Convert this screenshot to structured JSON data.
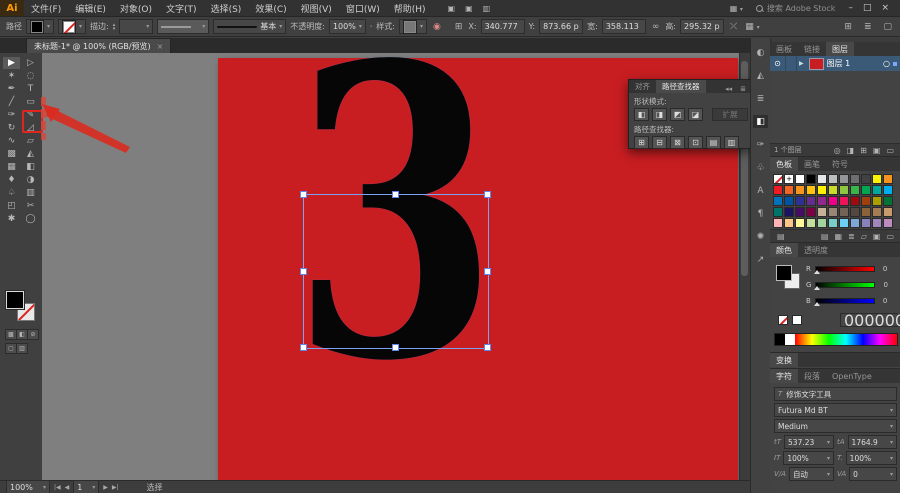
{
  "menu_bar": {
    "logo": "Ai",
    "items": [
      "文件(F)",
      "编辑(E)",
      "对象(O)",
      "文字(T)",
      "选择(S)",
      "效果(C)",
      "视图(V)",
      "窗口(W)",
      "帮助(H)"
    ],
    "quick_icons": [
      "▣",
      "▣",
      "▥"
    ],
    "workspace_icon": "▦",
    "search_label": "搜索 Adobe Stock",
    "window_controls": [
      {
        "name": "minimize-button",
        "glyph": "–"
      },
      {
        "name": "maximize-button",
        "glyph": "□"
      },
      {
        "name": "close-button",
        "glyph": "×"
      }
    ]
  },
  "control_bar": {
    "context_label": "路径",
    "stroke_label": "描边:",
    "brush_value": "基本",
    "opacity_label": "不透明度:",
    "opacity_value": "100%",
    "style_label": "样式:",
    "ref_icon": "⊞",
    "x_label": "X:",
    "x_value": "340.777",
    "y_label": "Y:",
    "y_value": "873.66 p",
    "w_label": "宽:",
    "w_value": "358.113",
    "link_icon": "∞",
    "h_label": "高:",
    "h_value": "295.32 p",
    "extra_icons": [
      "⤫",
      "▦"
    ],
    "right_icons": [
      "⊞",
      "≣",
      "▢"
    ]
  },
  "document_tab": {
    "title": "未标题-1* @ 100% (RGB/预览)",
    "close_glyph": "×"
  },
  "toolbar": {
    "tools": [
      {
        "name": "selection-tool",
        "glyph": "▶",
        "active": true
      },
      {
        "name": "direct-selection-tool",
        "glyph": "▷"
      },
      {
        "name": "magic-wand-tool",
        "glyph": "✶"
      },
      {
        "name": "lasso-tool",
        "glyph": "◌"
      },
      {
        "name": "pen-tool",
        "glyph": "✒"
      },
      {
        "name": "type-tool",
        "glyph": "T"
      },
      {
        "name": "line-segment-tool",
        "glyph": "╱"
      },
      {
        "name": "rectangle-tool",
        "glyph": "▭"
      },
      {
        "name": "paintbrush-tool",
        "glyph": "✑"
      },
      {
        "name": "pencil-tool",
        "glyph": "✎"
      },
      {
        "name": "rotate-tool",
        "glyph": "↻"
      },
      {
        "name": "scale-tool",
        "glyph": "◿"
      },
      {
        "name": "width-tool",
        "glyph": "∿"
      },
      {
        "name": "free-transform-tool",
        "glyph": "▱"
      },
      {
        "name": "shape-builder-tool",
        "glyph": "▩"
      },
      {
        "name": "perspective-grid-tool",
        "glyph": "◭"
      },
      {
        "name": "mesh-tool",
        "glyph": "▦"
      },
      {
        "name": "gradient-tool",
        "glyph": "◧"
      },
      {
        "name": "eyedropper-tool",
        "glyph": "♦"
      },
      {
        "name": "blend-tool",
        "glyph": "◑"
      },
      {
        "name": "symbol-sprayer-tool",
        "glyph": "♤"
      },
      {
        "name": "column-graph-tool",
        "glyph": "▥"
      },
      {
        "name": "artboard-tool",
        "glyph": "◰"
      },
      {
        "name": "slice-tool",
        "glyph": "✂"
      },
      {
        "name": "hand-tool",
        "glyph": "✱"
      },
      {
        "name": "zoom-tool",
        "glyph": "◯"
      }
    ]
  },
  "canvas": {
    "artboard_color": "#c81e22",
    "glyph": "3"
  },
  "pathfinder_panel": {
    "tabs": [
      {
        "label": "对齐",
        "active": false
      },
      {
        "label": "路径查找器",
        "active": true
      }
    ],
    "collapse_icon": "◂◂",
    "menu_icon": "≣",
    "shape_modes_label": "形状模式:",
    "shape_mode_icons": [
      {
        "name": "unite",
        "glyph": "◧"
      },
      {
        "name": "minus-front",
        "glyph": "◨"
      },
      {
        "name": "intersect",
        "glyph": "◩"
      },
      {
        "name": "exclude",
        "glyph": "◪"
      }
    ],
    "expand_label": "扩展",
    "pathfinders_label": "路径查找器:",
    "pathfinder_icons": [
      {
        "name": "divide",
        "glyph": "⊞"
      },
      {
        "name": "trim",
        "glyph": "⊟"
      },
      {
        "name": "merge",
        "glyph": "⊠"
      },
      {
        "name": "crop",
        "glyph": "⊡"
      },
      {
        "name": "outline",
        "glyph": "▤"
      },
      {
        "name": "minus-back",
        "glyph": "▥"
      }
    ]
  },
  "dock_strip": {
    "icons": [
      {
        "name": "color-panel-icon",
        "glyph": "◐"
      },
      {
        "name": "color-guide-panel-icon",
        "glyph": "◭"
      },
      {
        "name": "align-panel-icon",
        "glyph": "≣"
      },
      {
        "name": "pathfinder-panel-icon",
        "glyph": "◧",
        "active": true
      },
      {
        "name": "brushes-panel-icon",
        "glyph": "✑"
      },
      {
        "name": "symbols-panel-icon",
        "glyph": "♧"
      },
      {
        "name": "character-styles-panel-icon",
        "glyph": "A"
      },
      {
        "name": "paragraph-styles-panel-icon",
        "glyph": "¶"
      },
      {
        "name": "glyphs-panel-icon",
        "glyph": "✺"
      },
      {
        "name": "export-panel-icon",
        "glyph": "↗"
      }
    ]
  },
  "layers_panel": {
    "tabs": [
      {
        "label": "画板"
      },
      {
        "label": "链接"
      },
      {
        "label": "图层",
        "active": true
      }
    ],
    "eye_glyph": "⊙",
    "expand_glyph": "▶",
    "layer_name": "图层 1",
    "target_glyph": "○",
    "footer_label": "1 个图层",
    "footer_icons": [
      {
        "name": "locate-object-icon",
        "glyph": "◎"
      },
      {
        "name": "make-clip-mask-icon",
        "glyph": "◨"
      },
      {
        "name": "new-sublayer-icon",
        "glyph": "⊞"
      },
      {
        "name": "new-layer-icon",
        "glyph": "▣"
      },
      {
        "name": "delete-layer-icon",
        "glyph": "▭"
      }
    ]
  },
  "swatches_panel": {
    "tabs": [
      {
        "label": "色板",
        "active": true
      },
      {
        "label": "画笔"
      },
      {
        "label": "符号"
      }
    ],
    "rows": [
      [
        "none",
        "reg",
        "#ffffff",
        "#000000",
        "#e6e7e8",
        "#bcbec0",
        "#939598",
        "#6d6e71",
        "#414042",
        "#fff200",
        "#f7941e"
      ],
      [
        "#ed1c24",
        "#f26522",
        "#f7941e",
        "#ffc20e",
        "#fff200",
        "#cbdb2a",
        "#8dc63f",
        "#39b54a",
        "#00a651",
        "#00a99d",
        "#00aeef"
      ],
      [
        "#0072bc",
        "#0054a6",
        "#2e3192",
        "#662d91",
        "#92278f",
        "#ec008c",
        "#ed145b",
        "#9e0b0f",
        "#a0410d",
        "#aba000",
        "#007236"
      ],
      [
        "#00746b",
        "#1b1464",
        "#440e62",
        "#7b0046",
        "#c7b299",
        "#998675",
        "#736357",
        "#534741",
        "#8c6239",
        "#a67c52",
        "#c69c6d"
      ],
      [
        "#fbb3b3",
        "#fdc689",
        "#fff799",
        "#c4df9b",
        "#a3d39c",
        "#7accc8",
        "#6dcff6",
        "#7da7d9",
        "#8781bd",
        "#a186be",
        "#bd8cbf"
      ]
    ],
    "footer_icons": [
      {
        "name": "swatch-libraries-icon",
        "glyph": "▤"
      },
      {
        "name": "show-swatch-kinds-icon",
        "glyph": "▦"
      },
      {
        "name": "swatch-options-icon",
        "glyph": "≣"
      },
      {
        "name": "new-color-group-icon",
        "glyph": "▱"
      },
      {
        "name": "new-swatch-icon",
        "glyph": "▣"
      },
      {
        "name": "delete-swatch-icon",
        "glyph": "▭"
      }
    ]
  },
  "color_panel": {
    "tabs": [
      {
        "label": "颜色",
        "active": true
      },
      {
        "label": "透明度"
      }
    ],
    "channels": [
      {
        "label": "R",
        "value": "0",
        "to": "#ff0000"
      },
      {
        "label": "G",
        "value": "0",
        "to": "#00ff00"
      },
      {
        "label": "B",
        "value": "0",
        "to": "#0000ff"
      }
    ],
    "hex_value": "000000"
  },
  "transform_bar": {
    "title": "变换"
  },
  "character_panel": {
    "tabs": [
      {
        "label": "字符",
        "active": true
      },
      {
        "label": "段落"
      },
      {
        "label": "OpenType"
      }
    ],
    "touch_type_label": "修饰文字工具",
    "touch_type_icon": "T",
    "font_family": "Futura Md BT",
    "font_style": "Medium",
    "fields": [
      {
        "name": "font-size-field",
        "icon": "tT",
        "value": "537.23"
      },
      {
        "name": "leading-field",
        "icon": "tA",
        "value": "1764.9"
      },
      {
        "name": "vertical-scale-field",
        "icon": "IT",
        "value": "100%"
      },
      {
        "name": "horizontal-scale-field",
        "icon": "T.",
        "value": "100%"
      },
      {
        "name": "kerning-field",
        "icon": "V/A",
        "value": "自动"
      },
      {
        "name": "tracking-field",
        "icon": "VA",
        "value": "0"
      }
    ]
  },
  "status_bar": {
    "zoom_value": "100%",
    "nav_glyphs": [
      "|◀",
      "◀",
      "▶",
      "▶|"
    ],
    "artboard_value": "1",
    "tool_name": "选择"
  }
}
